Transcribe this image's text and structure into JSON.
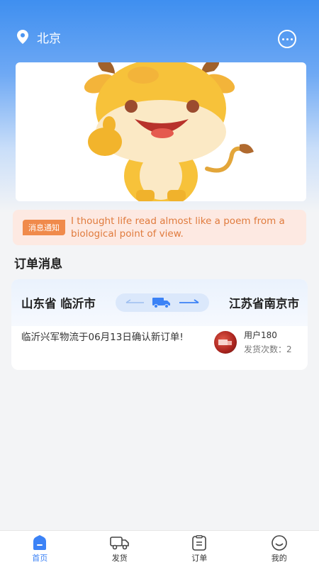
{
  "header": {
    "city": "北京"
  },
  "notice": {
    "tag": "消息通知",
    "text": "I thought life read almost like a poem from a biological point of view."
  },
  "section": {
    "title": "订单消息"
  },
  "order": {
    "from": "山东省 临沂市",
    "to": "江苏省南京市",
    "description": "临沂兴军物流于06月13日确认新订单!",
    "user": {
      "name": "用户180",
      "shipments": "发货次数：2"
    }
  },
  "tabs": [
    {
      "label": "首页",
      "icon": "home-icon",
      "active": true
    },
    {
      "label": "发货",
      "icon": "truck-icon",
      "active": false
    },
    {
      "label": "订单",
      "icon": "clipboard-icon",
      "active": false
    },
    {
      "label": "我的",
      "icon": "smile-icon",
      "active": false
    }
  ],
  "colors": {
    "accent": "#3b82f6",
    "notice_bg": "#fde9e2",
    "notice_tag": "#f08a4b"
  }
}
